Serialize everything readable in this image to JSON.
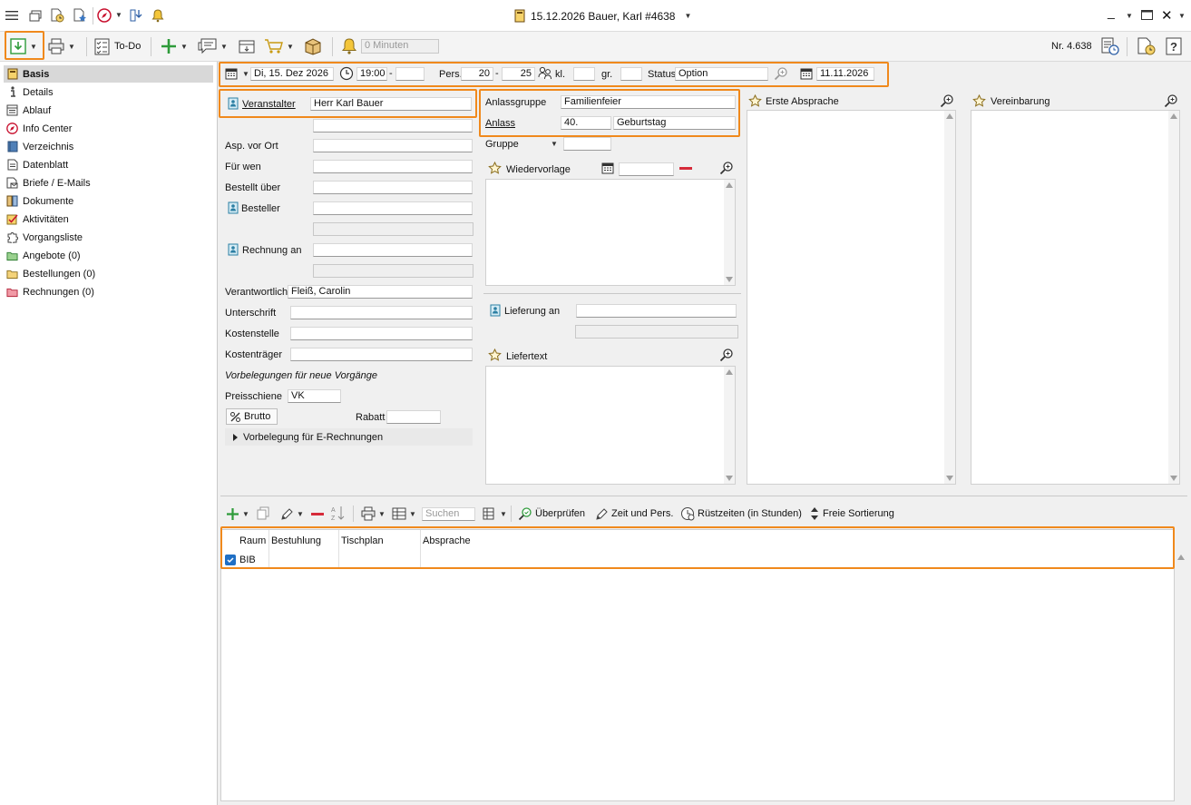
{
  "window": {
    "title": "15.12.2026 Bauer, Karl #4638",
    "minimize": "_",
    "close": "✕"
  },
  "toolbar": {
    "todo_label": "To-Do",
    "reminder_placeholder": "0 Minuten",
    "record_number": "Nr. 4.638"
  },
  "sidebar": {
    "items": [
      {
        "label": "Basis"
      },
      {
        "label": "Details"
      },
      {
        "label": "Ablauf"
      },
      {
        "label": "Info Center"
      },
      {
        "label": "Verzeichnis"
      },
      {
        "label": "Datenblatt"
      },
      {
        "label": "Briefe / E-Mails"
      },
      {
        "label": "Dokumente"
      },
      {
        "label": "Aktivitäten"
      },
      {
        "label": "Vorgangsliste"
      },
      {
        "label": "Angebote (0)"
      },
      {
        "label": "Bestellungen (0)"
      },
      {
        "label": "Rechnungen (0)"
      }
    ]
  },
  "header_row": {
    "date": "Di, 15. Dez 2026",
    "time_from": "19:00",
    "time_sep": "-",
    "time_to": "",
    "pers_label": "Pers.",
    "pers_min": "20",
    "pers_sep": "-",
    "pers_max": "25",
    "kl_label": "kl.",
    "kl_value": "",
    "gr_label": "gr.",
    "gr_value": "",
    "status_label": "Status",
    "status_value": "Option",
    "option_date": "11.11.2026"
  },
  "form_left": {
    "veranstalter_label": "Veranstalter",
    "veranstalter_value": "Herr Karl Bauer",
    "asp_label": "Asp. vor Ort",
    "fuer_wen_label": "Für wen",
    "bestellt_ueber_label": "Bestellt über",
    "besteller_label": "Besteller",
    "rechnung_an_label": "Rechnung an",
    "verantwortlich_label": "Verantwortlich",
    "verantwortlich_value": "Fleiß, Carolin",
    "unterschrift_label": "Unterschrift",
    "kostenstelle_label": "Kostenstelle",
    "kostentraeger_label": "Kostenträger",
    "vorbelegungen_heading": "Vorbelegungen für neue Vorgänge",
    "preisschiene_label": "Preisschiene",
    "preisschiene_value": "VK",
    "brutto_label": "Brutto",
    "rabatt_label": "Rabatt",
    "erechnung_label": "Vorbelegung für E-Rechnungen"
  },
  "form_mid": {
    "anlassgruppe_label": "Anlassgruppe",
    "anlassgruppe_value": "Familienfeier",
    "anlass_label": "Anlass",
    "anlass_code": "40.",
    "anlass_value": "Geburtstag",
    "gruppe_label": "Gruppe",
    "wiedervorlage_label": "Wiedervorlage",
    "lieferung_label": "Lieferung an",
    "liefertext_label": "Liefertext"
  },
  "panels": {
    "erste_absprache": "Erste Absprache",
    "vereinbarung": "Vereinbarung"
  },
  "grid_toolbar": {
    "search_placeholder": "Suchen",
    "pruefen": "Überprüfen",
    "zeit_pers": "Zeit und Pers.",
    "ruestzeiten": "Rüstzeiten (in Stunden)",
    "sortierung": "Freie Sortierung"
  },
  "grid": {
    "columns": [
      "Raum",
      "Bestuhlung",
      "Tischplan",
      "Absprache"
    ],
    "rows": [
      {
        "checked": true,
        "raum": "BIB",
        "bestuhlung": "",
        "tischplan": "",
        "absprache": ""
      }
    ]
  },
  "colors": {
    "highlight": "#f0891c",
    "accent_green": "#2e9b3a",
    "accent_red": "#d62b3a",
    "selection_blue": "#1f6fc5"
  }
}
